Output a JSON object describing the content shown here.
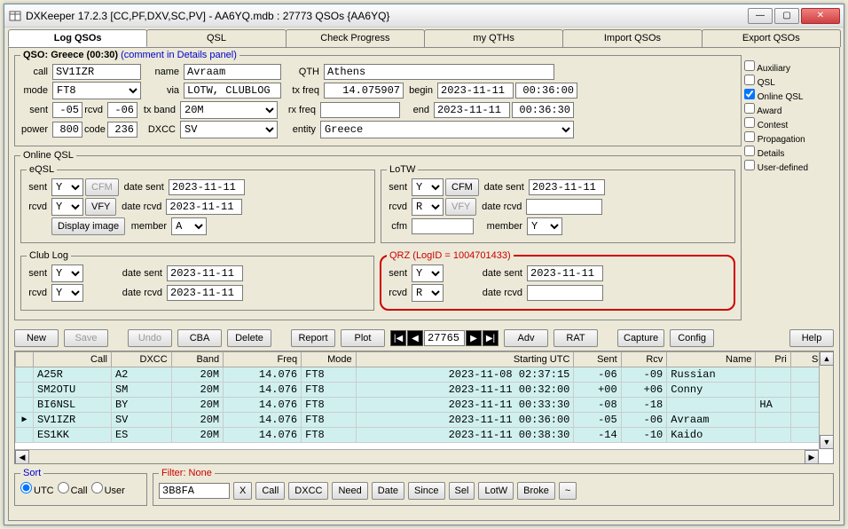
{
  "window": {
    "title": "DXKeeper 17.2.3 [CC,PF,DXV,SC,PV] - AA6YQ.mdb : 27773 QSOs {AA6YQ}"
  },
  "tabs": [
    "Log QSOs",
    "QSL",
    "Check Progress",
    "my QTHs",
    "Import QSOs",
    "Export QSOs"
  ],
  "qso_header": {
    "prefix": "QSO:",
    "country_time": "Greece (00:30)",
    "comment": "(comment in Details panel)"
  },
  "f": {
    "call_lbl": "call",
    "call": "SV1IZR",
    "name_lbl": "name",
    "name": "Avraam",
    "qth_lbl": "QTH",
    "qth": "Athens",
    "mode_lbl": "mode",
    "mode": "FT8",
    "via_lbl": "via",
    "via": "LOTW, CLUBLOG",
    "txfreq_lbl": "tx freq",
    "txfreq": "14.075907",
    "begin_lbl": "begin",
    "begin_date": "2023-11-11",
    "begin_time": "00:36:00",
    "sent_lbl": "sent",
    "sent": "-05",
    "rcvd_lbl": "rcvd",
    "rcvd": "-06",
    "txband_lbl": "tx band",
    "txband": "20M",
    "rxfreq_lbl": "rx freq",
    "rxfreq": "",
    "end_lbl": "end",
    "end_date": "2023-11-11",
    "end_time": "00:36:30",
    "power_lbl": "power",
    "power": "800",
    "code_lbl": "code",
    "code": "236",
    "dxcc_lbl": "DXCC",
    "dxcc": "SV",
    "entity_lbl": "entity",
    "entity": "Greece"
  },
  "sidecb": [
    "Auxiliary",
    "QSL",
    "Online QSL",
    "Award",
    "Contest",
    "Propagation",
    "Details",
    "User-defined"
  ],
  "sidecb_checked": [
    false,
    false,
    true,
    false,
    false,
    false,
    false,
    false
  ],
  "online_legend": "Online QSL",
  "eqsl": {
    "legend": "eQSL",
    "sent_lbl": "sent",
    "sent": "Y",
    "cfm_btn": "CFM",
    "date_sent_lbl": "date sent",
    "date_sent": "2023-11-11",
    "rcvd_lbl": "rcvd",
    "rcvd": "Y",
    "vfy_btn": "VFY",
    "date_rcvd_lbl": "date rcvd",
    "date_rcvd": "2023-11-11",
    "display_btn": "Display image",
    "member_lbl": "member",
    "member": "A"
  },
  "lotw": {
    "legend": "LoTW",
    "sent_lbl": "sent",
    "sent": "Y",
    "cfm_btn": "CFM",
    "date_sent_lbl": "date sent",
    "date_sent": "2023-11-11",
    "rcvd_lbl": "rcvd",
    "rcvd": "R",
    "vfy_btn": "VFY",
    "date_rcvd_lbl": "date rcvd",
    "date_rcvd": "",
    "cfm_lbl": "cfm",
    "cfm": "",
    "member_lbl": "member",
    "member": "Y"
  },
  "clublog": {
    "legend": "Club Log",
    "sent_lbl": "sent",
    "sent": "Y",
    "date_sent_lbl": "date sent",
    "date_sent": "2023-11-11",
    "rcvd_lbl": "rcvd",
    "rcvd": "Y",
    "date_rcvd_lbl": "date rcvd",
    "date_rcvd": "2023-11-11"
  },
  "qrz": {
    "legend": "QRZ (LogID = 1004701433)",
    "sent_lbl": "sent",
    "sent": "Y",
    "date_sent_lbl": "date sent",
    "date_sent": "2023-11-11",
    "rcvd_lbl": "rcvd",
    "rcvd": "R",
    "date_rcvd_lbl": "date rcvd",
    "date_rcvd": ""
  },
  "buttons": {
    "new": "New",
    "save": "Save",
    "undo": "Undo",
    "cba": "CBA",
    "delete": "Delete",
    "report": "Report",
    "plot": "Plot",
    "adv": "Adv",
    "rat": "RAT",
    "capture": "Capture",
    "config": "Config",
    "help": "Help",
    "nav_num": "27765"
  },
  "grid": {
    "cols": [
      "",
      "Call",
      "DXCC",
      "Band",
      "Freq",
      "Mode",
      "Starting UTC",
      "Sent",
      "Rcv",
      "Name",
      "Pri",
      "Sec"
    ],
    "rows": [
      {
        "m": "",
        "call": "A25R",
        "dxcc": "A2",
        "band": "20M",
        "freq": "14.076",
        "mode": "FT8",
        "utc": "2023-11-08  02:37:15",
        "sent": "-06",
        "rcv": "-09",
        "name": "Russian",
        "pri": "",
        "sec": ""
      },
      {
        "m": "",
        "call": "SM2OTU",
        "dxcc": "SM",
        "band": "20M",
        "freq": "14.076",
        "mode": "FT8",
        "utc": "2023-11-11  00:32:00",
        "sent": "+00",
        "rcv": "+06",
        "name": "Conny",
        "pri": "",
        "sec": ""
      },
      {
        "m": "",
        "call": "BI6NSL",
        "dxcc": "BY",
        "band": "20M",
        "freq": "14.076",
        "mode": "FT8",
        "utc": "2023-11-11  00:33:30",
        "sent": "-08",
        "rcv": "-18",
        "name": "",
        "pri": "HA",
        "sec": ""
      },
      {
        "m": "▶",
        "call": "SV1IZR",
        "dxcc": "SV",
        "band": "20M",
        "freq": "14.076",
        "mode": "FT8",
        "utc": "2023-11-11  00:36:00",
        "sent": "-05",
        "rcv": "-06",
        "name": "Avraam",
        "pri": "",
        "sec": ""
      },
      {
        "m": "",
        "call": "ES1KK",
        "dxcc": "ES",
        "band": "20M",
        "freq": "14.076",
        "mode": "FT8",
        "utc": "2023-11-11  00:38:30",
        "sent": "-14",
        "rcv": "-10",
        "name": "Kaido",
        "pri": "",
        "sec": ""
      }
    ]
  },
  "sort": {
    "legend": "Sort",
    "utc": "UTC",
    "call": "Call",
    "user": "User"
  },
  "filter": {
    "legend": "Filter: None",
    "value": "3B8FA",
    "x": "X",
    "btns": [
      "Call",
      "DXCC",
      "Need",
      "Date",
      "Since",
      "Sel",
      "LotW",
      "Broke",
      "~"
    ]
  }
}
